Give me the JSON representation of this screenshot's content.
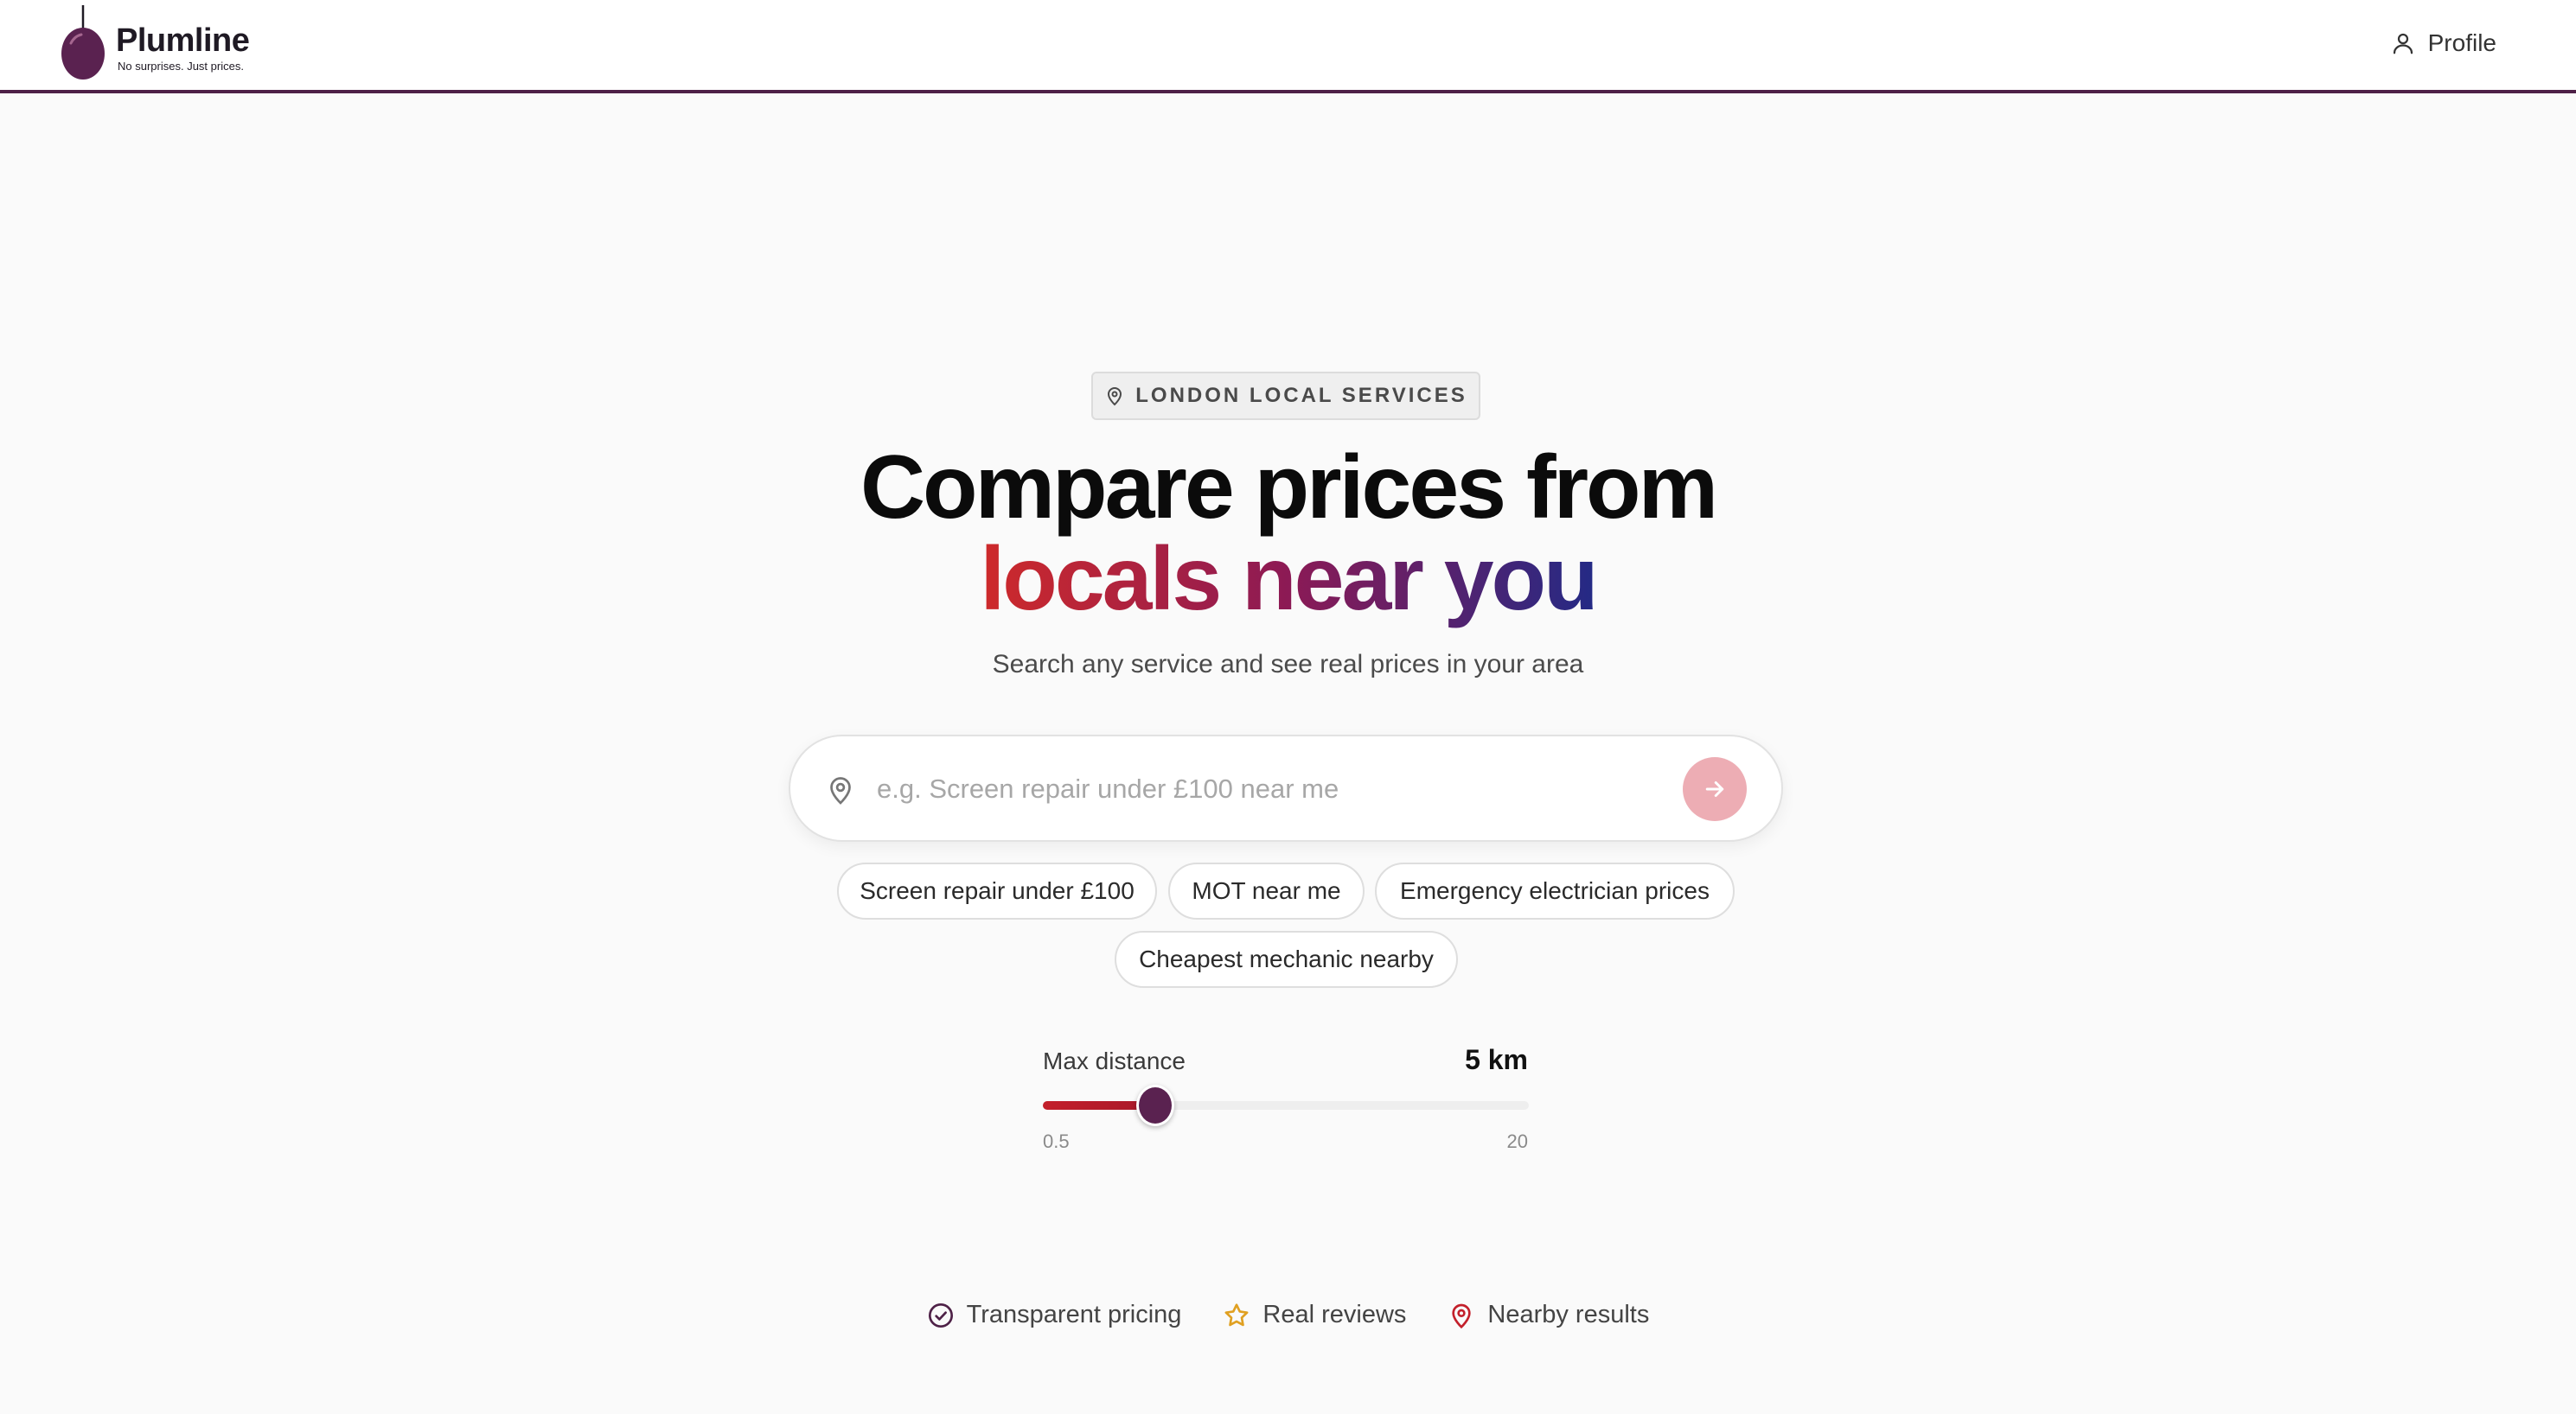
{
  "brand": {
    "name": "Plumline",
    "tagline": "No surprises. Just prices.",
    "color": "#4e2147"
  },
  "header": {
    "profile_label": "Profile"
  },
  "hero": {
    "badge": "LONDON LOCAL SERVICES",
    "title_line1": "Compare prices from",
    "title_line2": "locals near you",
    "subtitle": "Search any service and see real prices in your area"
  },
  "search": {
    "placeholder": "e.g. Screen repair under £100 near me",
    "value": ""
  },
  "suggestions": [
    "Screen repair under £100",
    "MOT near me",
    "Emergency electrician prices",
    "Cheapest mechanic nearby"
  ],
  "distance": {
    "label": "Max distance",
    "value_text": "5 km",
    "value": 5,
    "min": 0.5,
    "max": 20,
    "min_label": "0.5",
    "max_label": "20"
  },
  "features": [
    {
      "icon": "check-circle-icon",
      "label": "Transparent pricing",
      "color": "#4e2147"
    },
    {
      "icon": "star-icon",
      "label": "Real reviews",
      "color": "#e0a021"
    },
    {
      "icon": "map-pin-icon",
      "label": "Nearby results",
      "color": "#c3202b"
    }
  ],
  "colors": {
    "accent": "#c3202b",
    "plum": "#5a2250",
    "gradient_start": "#cf2a2a",
    "gradient_mid": "#8c1a55",
    "gradient_end": "#222a86"
  }
}
